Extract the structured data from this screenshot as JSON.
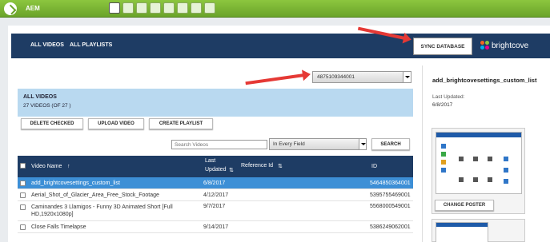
{
  "app": {
    "title": "AEM"
  },
  "nav": {
    "tabs": [
      {
        "label": "ALL VIDEOS"
      },
      {
        "label": "ALL PLAYLISTS"
      }
    ],
    "sync_label": "SYNC DATABASE",
    "brand_label": "brightcove"
  },
  "account": {
    "selected": "4875109344001"
  },
  "summary": {
    "title": "ALL VIDEOS",
    "count": "27 VIDEOS (OF 27 )"
  },
  "actions": {
    "delete_checked": "DELETE CHECKED",
    "upload_video": "UPLOAD VIDEO",
    "create_playlist": "CREATE PLAYLIST"
  },
  "search": {
    "placeholder": "Search Videos",
    "field_selected": "In Every Field",
    "button": "SEARCH"
  },
  "table": {
    "columns": {
      "name": "Video Name",
      "name_sort": "↑",
      "updated_line1": "Last",
      "updated_line2": "Updated",
      "updated_sort": "⇅",
      "ref": "Reference Id",
      "ref_sort": "⇅",
      "id": "ID"
    },
    "rows": [
      {
        "name": "add_brightcovesettings_custom_list",
        "updated": "6/8/2017",
        "ref": "",
        "id": "5464850364001"
      },
      {
        "name": "Aerial_Shot_of_Glacier_Area_Free_Stock_Footage",
        "updated": "4/12/2017",
        "ref": "",
        "id": "5395755469001"
      },
      {
        "name": "Caminandes 3 Llamigos - Funny 3D Animated Short [Full HD,1920x1080p]",
        "updated": "9/7/2017",
        "ref": "",
        "id": "5568000549001"
      },
      {
        "name": "Close Falls Timelapse",
        "updated": "9/14/2017",
        "ref": "",
        "id": "5386249062001"
      }
    ]
  },
  "detail": {
    "title": "add_brightcovesettings_custom_list",
    "last_updated_label": "Last Updated:",
    "last_updated_value": "6/8/2017",
    "change_poster": "CHANGE POSTER"
  },
  "colors": {
    "topbar": "#7db535",
    "navbar": "#1e3c64",
    "selected_row": "#3d8fd6",
    "summary_bg": "#b9d9f0",
    "arrow": "#e53935"
  }
}
